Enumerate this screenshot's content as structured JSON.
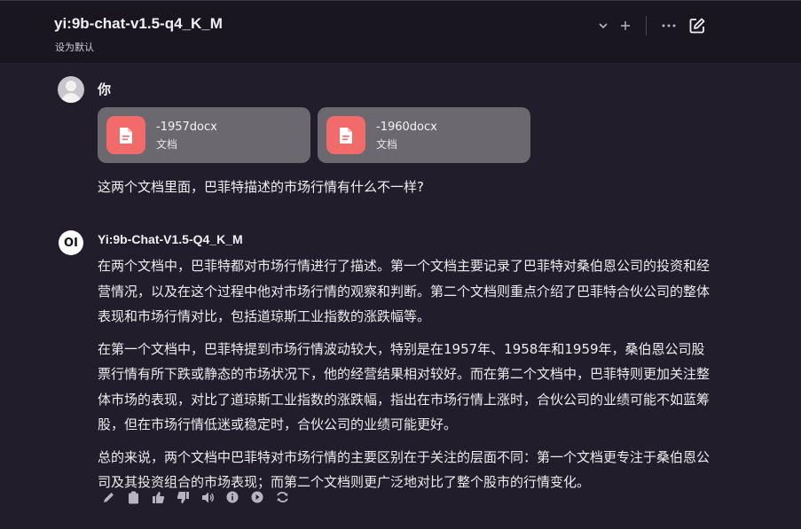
{
  "header": {
    "model_title": "yi:9b-chat-v1.5-q4_K_M",
    "set_default_label": "设为默认"
  },
  "user": {
    "name": "你",
    "files": [
      {
        "name": "-1957docx",
        "type": "文档"
      },
      {
        "name": "-1960docx",
        "type": "文档"
      }
    ],
    "message": "这两个文档里面，巴菲特描述的市场行情有什么不一样?"
  },
  "assistant": {
    "avatar_text": "OI",
    "name": "Yi:9b-Chat-V1.5-Q4_K_M",
    "paragraphs": [
      "在两个文档中，巴菲特都对市场行情进行了描述。第一个文档主要记录了巴菲特对桑伯恩公司的投资和经营情况，以及在这个过程中他对市场行情的观察和判断。第二个文档则重点介绍了巴菲特合伙公司的整体表现和市场行情对比，包括道琼斯工业指数的涨跌幅等。",
      "在第一个文档中，巴菲特提到市场行情波动较大，特别是在1957年、1958年和1959年，桑伯恩公司股票行情有所下跌或静态的市场状况下，他的经营结果相对较好。而在第二个文档中，巴菲特则更加关注整体市场的表现，对比了道琼斯工业指数的涨跌幅，指出在市场行情上涨时，合伙公司的业绩可能不如蓝筹股，但在市场行情低迷或稳定时，合伙公司的业绩可能更好。",
      "总的来说，两个文档中巴菲特对市场行情的主要区别在于关注的层面不同：第一个文档更专注于桑伯恩公司及其投资组合的市场表现；而第二个文档则更广泛地对比了整个股市的行情变化。"
    ]
  },
  "icons": {
    "header": [
      "chevron-down-icon",
      "plus-icon",
      "more-icon",
      "edit-icon"
    ],
    "actions": [
      "edit-icon",
      "copy-icon",
      "thumbs-up-icon",
      "thumbs-down-icon",
      "speaker-icon",
      "info-icon",
      "continue-icon",
      "regenerate-icon"
    ]
  },
  "colors": {
    "background": "#221d2b",
    "header_background": "#1a1620",
    "file_card": "#6b6870",
    "file_icon": "#f26b6b"
  }
}
